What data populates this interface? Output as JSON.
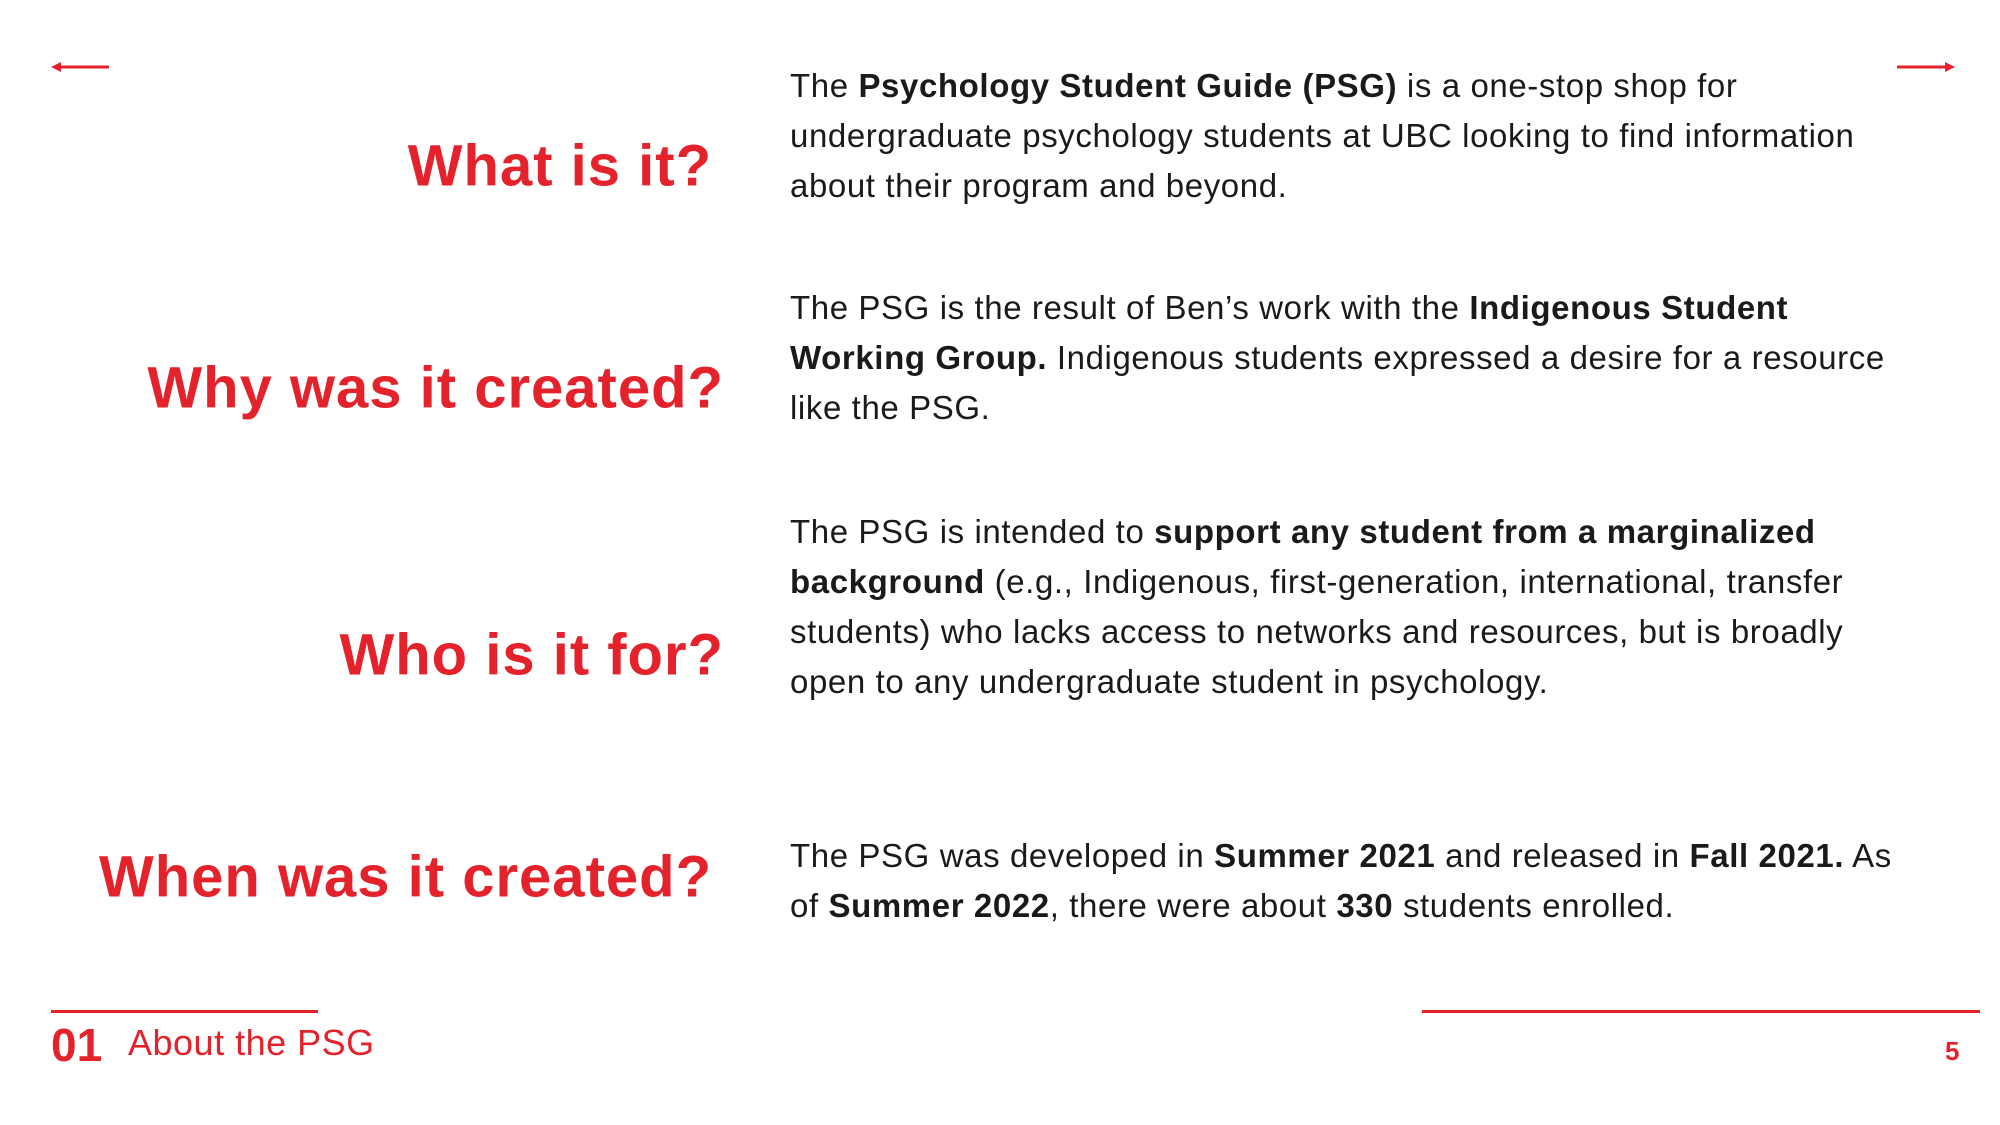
{
  "accent_color": "#e3222b",
  "nav": {
    "prev_icon": "arrow-left-icon",
    "next_icon": "arrow-right-icon"
  },
  "sections": [
    {
      "question": "What is it?",
      "answer": [
        {
          "t": "The ",
          "b": false
        },
        {
          "t": "Psychology Student Guide (PSG)",
          "b": true
        },
        {
          "t": " is a one-stop shop for undergraduate psychology students at UBC looking to find information about their program and beyond.",
          "b": false
        }
      ]
    },
    {
      "question": "Why was it created?",
      "answer": [
        {
          "t": "The PSG is the result of Ben’s work with the ",
          "b": false
        },
        {
          "t": "Indigenous Student Working Group.",
          "b": true
        },
        {
          "t": " Indigenous students expressed a desire for a resource like the PSG.",
          "b": false
        }
      ]
    },
    {
      "question": "Who is it for?",
      "answer": [
        {
          "t": "The PSG is intended to ",
          "b": false
        },
        {
          "t": "support any student from a marginalized background",
          "b": true
        },
        {
          "t": " (e.g., Indigenous, first-generation, international, transfer students) who lacks access to networks and resources, but is broadly open to any undergraduate student in psychology.",
          "b": false
        }
      ]
    },
    {
      "question": "When was it created?",
      "answer": [
        {
          "t": "The PSG was developed in ",
          "b": false
        },
        {
          "t": "Summer 2021",
          "b": true
        },
        {
          "t": " and released in ",
          "b": false
        },
        {
          "t": "Fall 2021.",
          "b": true
        },
        {
          "t": " As of ",
          "b": false
        },
        {
          "t": "Summer 2022",
          "b": true
        },
        {
          "t": ", there were about ",
          "b": false
        },
        {
          "t": "330",
          "b": true
        },
        {
          "t": " students enrolled.",
          "b": false
        }
      ]
    }
  ],
  "footer": {
    "section_number": "01",
    "section_title": "About the PSG",
    "page_number": "5"
  }
}
